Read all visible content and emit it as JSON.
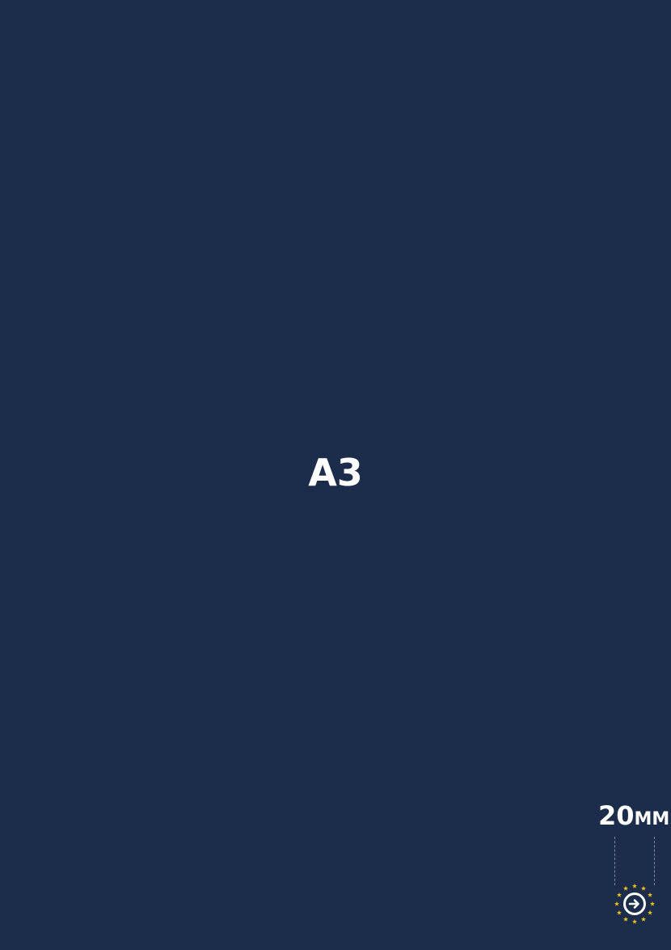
{
  "page": {
    "background": "#1b2d4a",
    "format_label": "A3",
    "size": {
      "value": "20",
      "unit": "MM"
    },
    "badge": {
      "icon": "eu-stars-arrow-logo-icon",
      "star_color": "#f2c21a",
      "ring_color": "#ffffff"
    }
  }
}
